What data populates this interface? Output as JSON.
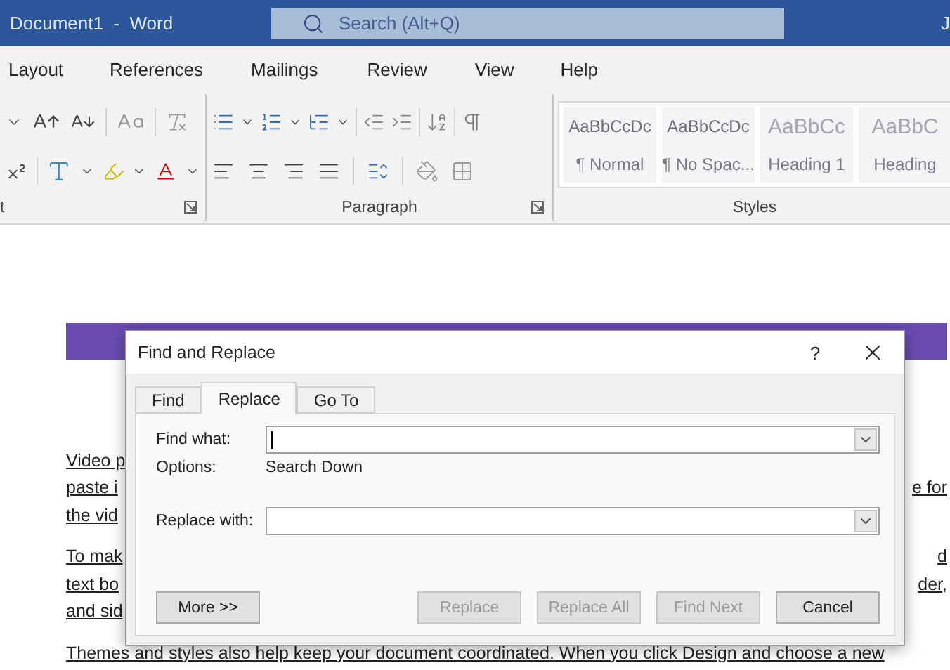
{
  "title_bar": {
    "document": "Document1  -  Word",
    "search": {
      "placeholder": "Search (Alt+Q)"
    },
    "account": "J"
  },
  "ribbon_tabs": [
    "Layout",
    "References",
    "Mailings",
    "Review",
    "View",
    "Help"
  ],
  "ribbon_groups": [
    {
      "label": "t"
    },
    {
      "label": "Paragraph"
    },
    {
      "label": "Styles"
    }
  ],
  "styles": [
    {
      "preview": "AaBbCcDc",
      "name": "¶ Normal",
      "kind": "body"
    },
    {
      "preview": "AaBbCcDc",
      "name": "¶ No Spac...",
      "kind": "body"
    },
    {
      "preview": "AaBbCc",
      "name": "Heading 1",
      "kind": "heading"
    },
    {
      "preview": "AaBbC",
      "name": "Heading",
      "kind": "heading"
    }
  ],
  "document": {
    "paragraphs": [
      {
        "lines": [
          {
            "left": "Video p"
          },
          {
            "left": "paste i",
            "right": "e for"
          },
          {
            "left": "the vid"
          }
        ]
      },
      {
        "lines": [
          {
            "left": "To mak",
            "right": "d"
          },
          {
            "left": "text bo",
            "right": "der,"
          },
          {
            "left": "and sid"
          }
        ]
      },
      {
        "lines": [
          {
            "left": "Themes and styles also help keep your document coordinated. When you click Design and choose a new"
          }
        ]
      }
    ]
  },
  "dialog": {
    "title": "Find and Replace",
    "help": "?",
    "tabs": [
      {
        "label": "Find",
        "selected": false
      },
      {
        "label": "Replace",
        "selected": true
      },
      {
        "label": "Go To",
        "selected": false
      }
    ],
    "find_label": "Find what:",
    "options_label": "Options:",
    "options_value": "Search Down",
    "replace_label": "Replace with:",
    "buttons": [
      {
        "label": "More >>",
        "disabled": false
      },
      {
        "label": "Replace",
        "disabled": true
      },
      {
        "label": "Replace All",
        "disabled": true
      },
      {
        "label": "Find Next",
        "disabled": true
      },
      {
        "label": "Cancel",
        "disabled": false
      }
    ]
  }
}
